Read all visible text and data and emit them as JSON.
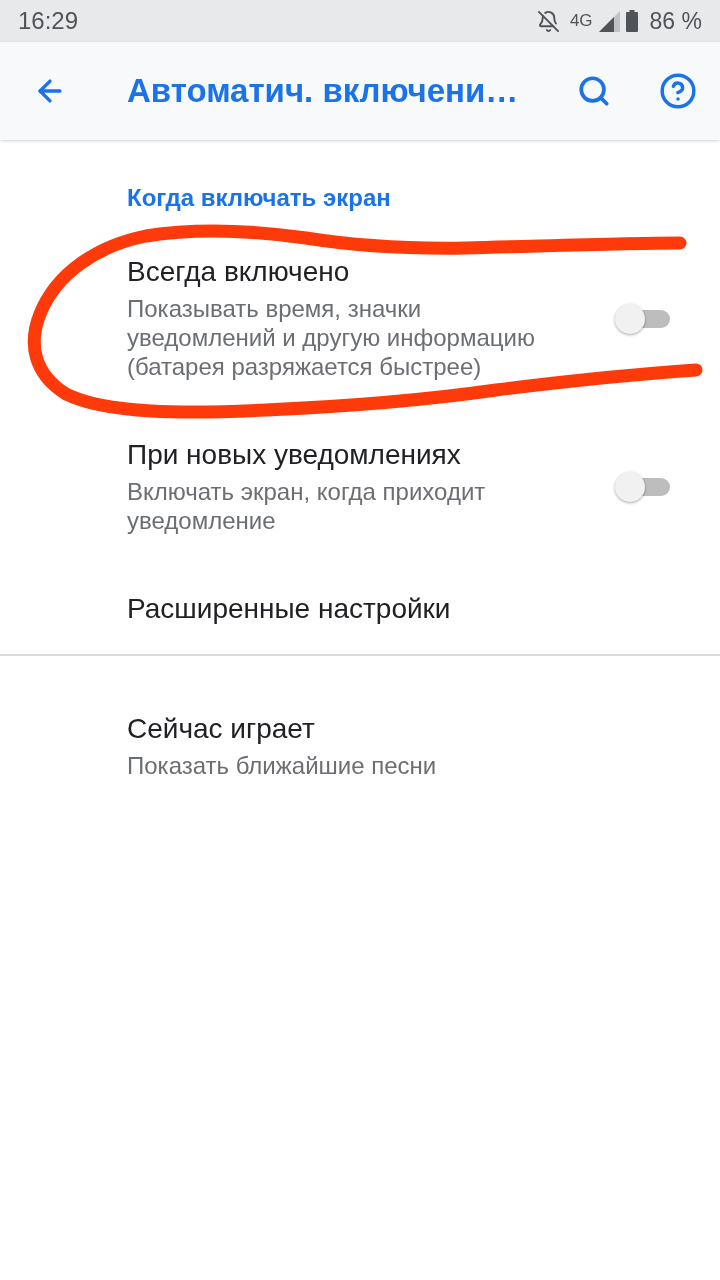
{
  "status_bar": {
    "time": "16:29",
    "network": "4G",
    "battery": "86 %"
  },
  "app_bar": {
    "title": "Автоматич. включени…"
  },
  "groups": [
    {
      "header": "Когда включать экран",
      "items": [
        {
          "kind": "switch",
          "title": "Всегда включено",
          "summary": "Показывать время, значки уведомлений и другую информацию (батарея разряжается быстрее)",
          "on": false
        },
        {
          "kind": "switch",
          "title": "При новых уведомлениях",
          "summary": "Включать экран, когда приходит уведомление",
          "on": false
        },
        {
          "kind": "plain",
          "title": "Расширенные настройки"
        }
      ]
    },
    {
      "items": [
        {
          "kind": "plain",
          "title": "Сейчас играет",
          "summary": "Показать ближайшие песни"
        }
      ]
    }
  ]
}
